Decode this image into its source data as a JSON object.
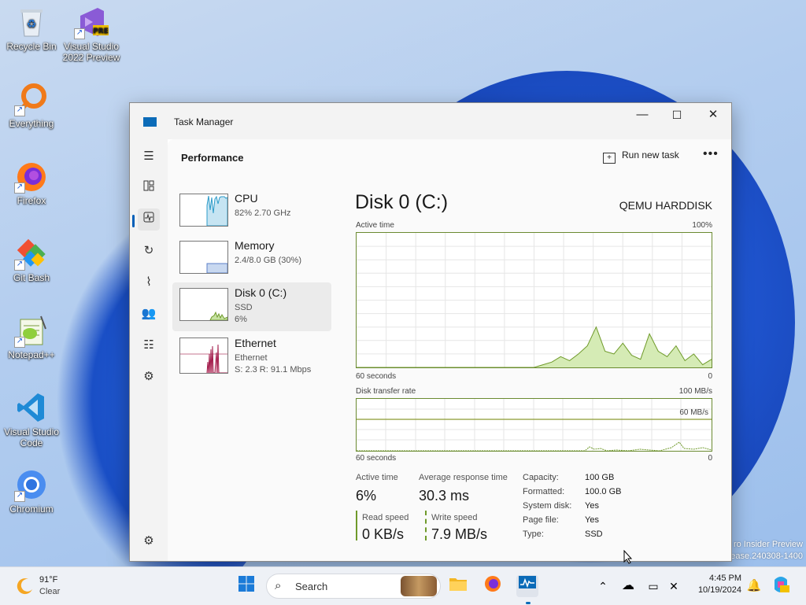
{
  "desktop": {
    "icons": [
      {
        "label1": "Recycle Bin",
        "label2": "",
        "icon": "recycle-bin-icon"
      },
      {
        "label1": "Visual Studio",
        "label2": "2022 Preview",
        "icon": "visual-studio-icon",
        "badge": "PRE"
      },
      {
        "label1": "Everything",
        "label2": "",
        "icon": "everything-search-icon"
      },
      {
        "label1": "Firefox",
        "label2": "",
        "icon": "firefox-icon"
      },
      {
        "label1": "Git Bash",
        "label2": "",
        "icon": "git-bash-icon"
      },
      {
        "label1": "Notepad++",
        "label2": "",
        "icon": "notepadpp-icon"
      },
      {
        "label1": "Visual Studio",
        "label2": "Code",
        "icon": "vscode-icon"
      },
      {
        "label1": "Chromium",
        "label2": "",
        "icon": "chromium-icon"
      }
    ],
    "watermark": {
      "line1": "ro Insider Preview",
      "line2": "ease.240308-1400"
    }
  },
  "window": {
    "title": "Task Manager",
    "controls": {
      "minimize": "—",
      "maximize": "☐",
      "close": "✕"
    },
    "nav_icons": [
      "hamburger-icon",
      "processes-icon",
      "performance-icon",
      "app-history-icon",
      "startup-apps-icon",
      "users-icon",
      "details-icon",
      "services-icon",
      "settings-icon"
    ],
    "page_title": "Performance",
    "run_new_task": "Run new task",
    "more": "•••"
  },
  "resources": [
    {
      "name": "CPU",
      "line1": "82%  2.70 GHz",
      "line2": ""
    },
    {
      "name": "Memory",
      "line1": "2.4/8.0 GB (30%)",
      "line2": ""
    },
    {
      "name": "Disk 0 (C:)",
      "line1": "SSD",
      "line2": "6%"
    },
    {
      "name": "Ethernet",
      "line1": "Ethernet",
      "line2": "S: 2.3  R: 91.1 Mbps"
    }
  ],
  "detail": {
    "title": "Disk 0 (C:)",
    "model": "QEMU HARDDISK",
    "active_time_graph": {
      "label": "Active time",
      "max": "100%",
      "left": "60 seconds",
      "right": "0"
    },
    "transfer_graph": {
      "label": "Disk transfer rate",
      "max": "100 MB/s",
      "ref": "60 MB/s",
      "left": "60 seconds",
      "right": "0"
    },
    "stats": {
      "active_time_label": "Active time",
      "active_time_value": "6%",
      "avg_response_label": "Average response time",
      "avg_response_value": "30.3 ms",
      "read_label": "Read speed",
      "read_value": "0 KB/s",
      "write_label": "Write speed",
      "write_value": "7.9 MB/s"
    },
    "properties": [
      {
        "key": "Capacity:",
        "value": "100 GB"
      },
      {
        "key": "Formatted:",
        "value": "100.0 GB"
      },
      {
        "key": "System disk:",
        "value": "Yes"
      },
      {
        "key": "Page file:",
        "value": "Yes"
      },
      {
        "key": "Type:",
        "value": "SSD"
      }
    ]
  },
  "chart_data": {
    "type": "area",
    "title": "Active time",
    "x": [
      60,
      58,
      56,
      54,
      52,
      50,
      48,
      46,
      44,
      42,
      40,
      38,
      36,
      34,
      32,
      30,
      28,
      26,
      24,
      22,
      20,
      18,
      16,
      14,
      12,
      10,
      8,
      6,
      4,
      2,
      0
    ],
    "series": [
      {
        "values": [
          0,
          0,
          0,
          0,
          0,
          0,
          0,
          0,
          0,
          0,
          0,
          0,
          0,
          0,
          0,
          0,
          0,
          0,
          0,
          0,
          0,
          2,
          4,
          8,
          5,
          10,
          16,
          30,
          12,
          10,
          18,
          9,
          6,
          25,
          12,
          8,
          16,
          5,
          10,
          2,
          6
        ]
      }
    ],
    "ylim": [
      0,
      100
    ]
  },
  "taskbar": {
    "weather_temp": "91°F",
    "weather_desc": "Clear",
    "search_placeholder": "Search",
    "time": "4:45 PM",
    "date": "10/19/2024"
  }
}
